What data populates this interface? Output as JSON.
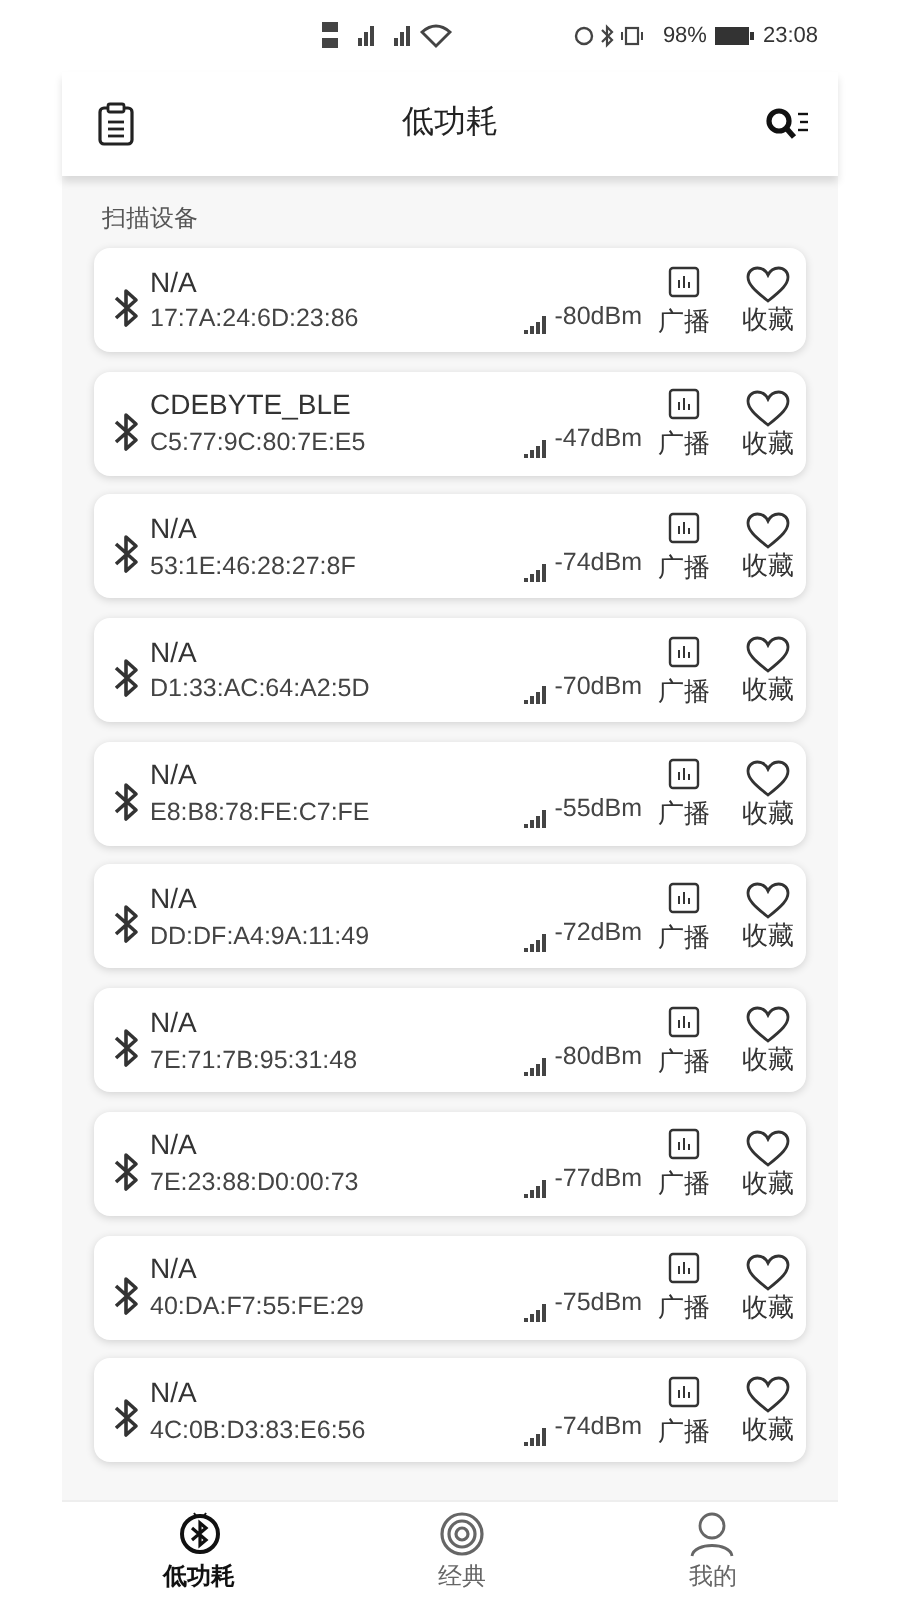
{
  "status_bar": {
    "battery": "98%",
    "time": "23:08"
  },
  "header": {
    "title": "低功耗"
  },
  "section_label": "扫描设备",
  "devices": [
    {
      "name": "N/A",
      "address": "17:7A:24:6D:23:86",
      "rssi": "-80dBm",
      "broadcast": "广播",
      "favorite": "收藏"
    },
    {
      "name": "CDEBYTE_BLE",
      "address": "C5:77:9C:80:7E:E5",
      "rssi": "-47dBm",
      "broadcast": "广播",
      "favorite": "收藏"
    },
    {
      "name": "N/A",
      "address": "53:1E:46:28:27:8F",
      "rssi": "-74dBm",
      "broadcast": "广播",
      "favorite": "收藏"
    },
    {
      "name": "N/A",
      "address": "D1:33:AC:64:A2:5D",
      "rssi": "-70dBm",
      "broadcast": "广播",
      "favorite": "收藏"
    },
    {
      "name": "N/A",
      "address": "E8:B8:78:FE:C7:FE",
      "rssi": "-55dBm",
      "broadcast": "广播",
      "favorite": "收藏"
    },
    {
      "name": "N/A",
      "address": "DD:DF:A4:9A:11:49",
      "rssi": "-72dBm",
      "broadcast": "广播",
      "favorite": "收藏"
    },
    {
      "name": "N/A",
      "address": "7E:71:7B:95:31:48",
      "rssi": "-80dBm",
      "broadcast": "广播",
      "favorite": "收藏"
    },
    {
      "name": "N/A",
      "address": "7E:23:88:D0:00:73",
      "rssi": "-77dBm",
      "broadcast": "广播",
      "favorite": "收藏"
    },
    {
      "name": "N/A",
      "address": "40:DA:F7:55:FE:29",
      "rssi": "-75dBm",
      "broadcast": "广播",
      "favorite": "收藏"
    },
    {
      "name": "N/A",
      "address": "4C:0B:D3:83:E6:56",
      "rssi": "-74dBm",
      "broadcast": "广播",
      "favorite": "收藏"
    }
  ],
  "bottom_nav": [
    {
      "kind": "ble",
      "label": "低功耗",
      "selected": true
    },
    {
      "kind": "classic",
      "label": "经典",
      "selected": false
    },
    {
      "kind": "profile",
      "label": "我的",
      "selected": false
    }
  ]
}
